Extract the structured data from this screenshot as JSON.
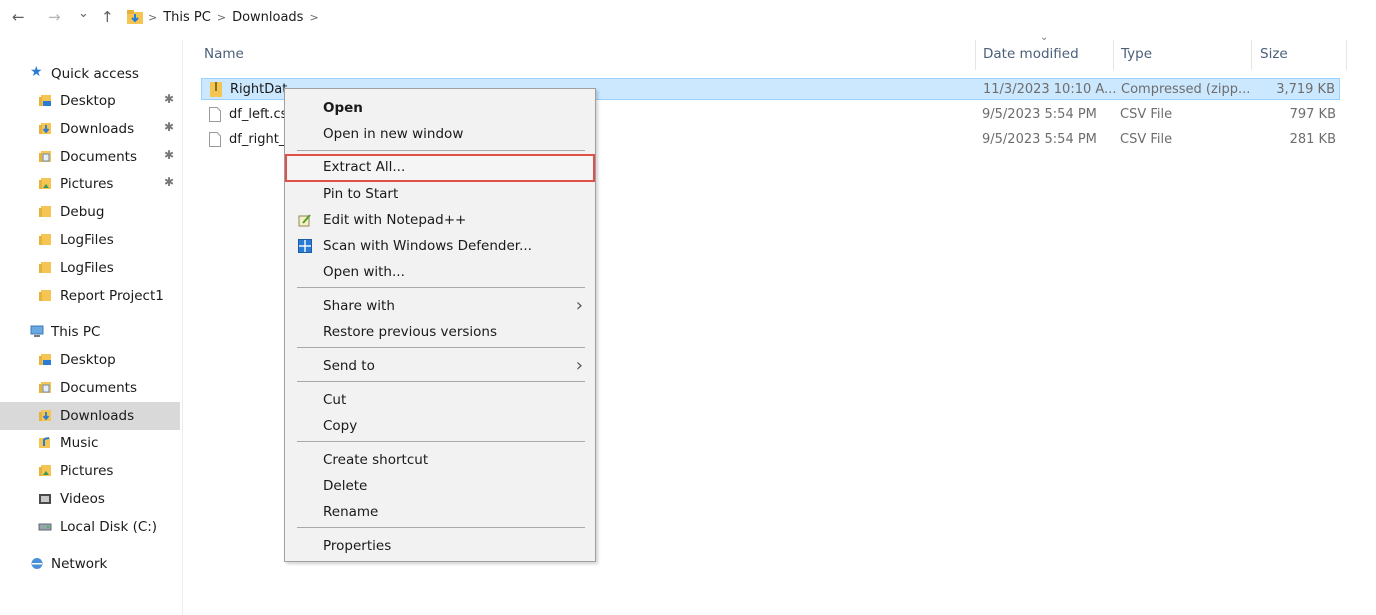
{
  "address": {
    "back_icon": "←",
    "forward_icon": "→",
    "recent_icon": "⌄",
    "up_icon": "↑",
    "path": [
      "This PC",
      "Downloads"
    ]
  },
  "sidebar": {
    "quick_access": "Quick access",
    "quick_items": [
      {
        "label": "Desktop",
        "icon": "desktop-folder-icon",
        "pinned": true
      },
      {
        "label": "Downloads",
        "icon": "downloads-folder-icon",
        "pinned": true
      },
      {
        "label": "Documents",
        "icon": "documents-folder-icon",
        "pinned": true
      },
      {
        "label": "Pictures",
        "icon": "pictures-folder-icon",
        "pinned": true
      },
      {
        "label": "Debug",
        "icon": "folder-icon",
        "pinned": false
      },
      {
        "label": "LogFiles",
        "icon": "folder-icon",
        "pinned": false
      },
      {
        "label": "LogFiles",
        "icon": "folder-icon",
        "pinned": false
      },
      {
        "label": "Report Project1",
        "icon": "folder-icon",
        "pinned": false
      }
    ],
    "this_pc": "This PC",
    "pc_items": [
      {
        "label": "Desktop",
        "icon": "desktop-folder-icon"
      },
      {
        "label": "Documents",
        "icon": "documents-folder-icon"
      },
      {
        "label": "Downloads",
        "icon": "downloads-folder-icon",
        "selected": true
      },
      {
        "label": "Music",
        "icon": "music-folder-icon"
      },
      {
        "label": "Pictures",
        "icon": "pictures-folder-icon"
      },
      {
        "label": "Videos",
        "icon": "videos-folder-icon"
      },
      {
        "label": "Local Disk (C:)",
        "icon": "drive-icon"
      }
    ],
    "network": "Network"
  },
  "columns": {
    "name": "Name",
    "date": "Date modified",
    "type": "Type",
    "size": "Size"
  },
  "files": [
    {
      "name": "RightData_Install",
      "name_visible": "RightDat",
      "date": "11/3/2023 10:10 A...",
      "type": "Compressed (zipp...",
      "size": "3,719 KB",
      "icon": "zip-folder-icon",
      "selected": true
    },
    {
      "name_visible": "df_left.csv",
      "date": "9/5/2023 5:54 PM",
      "type": "CSV File",
      "size": "797 KB",
      "icon": "file-icon"
    },
    {
      "name_visible": "df_right_",
      "date": "9/5/2023 5:54 PM",
      "type": "CSV File",
      "size": "281 KB",
      "icon": "file-icon"
    }
  ],
  "context_menu": {
    "open": "Open",
    "open_new_window": "Open in new window",
    "extract_all": "Extract All...",
    "pin_to_start": "Pin to Start",
    "edit_notepad": "Edit with Notepad++",
    "scan_defender": "Scan with Windows Defender...",
    "open_with": "Open with...",
    "share_with": "Share with",
    "restore_versions": "Restore previous versions",
    "send_to": "Send to",
    "cut": "Cut",
    "copy": "Copy",
    "create_shortcut": "Create shortcut",
    "delete": "Delete",
    "rename": "Rename",
    "properties": "Properties",
    "submenu_arrow": "›"
  },
  "colors": {
    "selection": "#cce8ff",
    "highlight_border": "#e0504a",
    "folder": "#f4c553"
  }
}
